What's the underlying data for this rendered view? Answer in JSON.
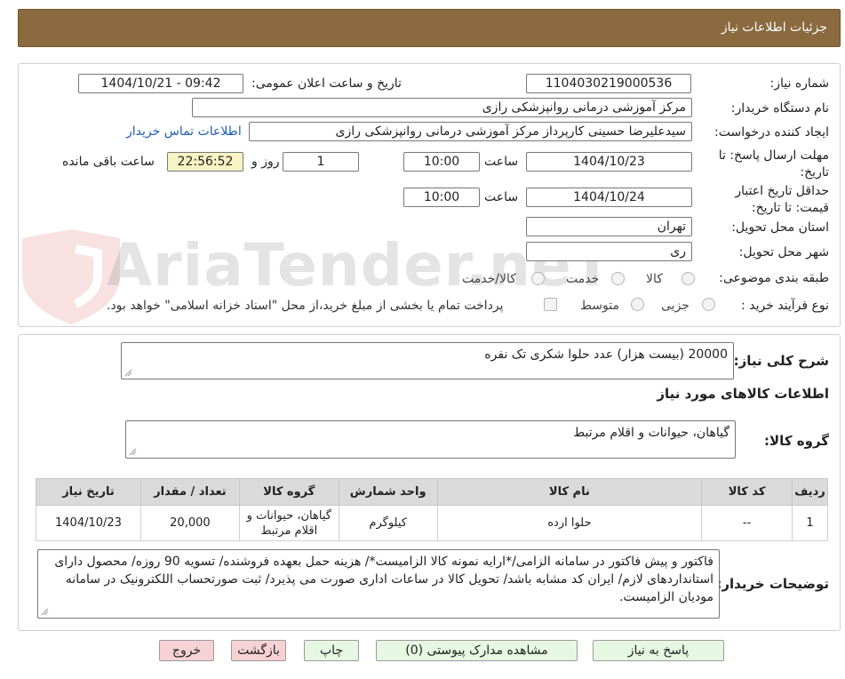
{
  "header": {
    "title": "جزئیات اطلاعات نیاز"
  },
  "form": {
    "need_number": {
      "label": "شماره نیاز:",
      "value": "1104030219000536"
    },
    "announce_datetime": {
      "label": "تاریخ و ساعت اعلان عمومی:",
      "value": "1404/10/21 - 09:42"
    },
    "buyer_org": {
      "label": "نام دستگاه خریدار:",
      "value": "مرکز آموزشی درمانی روانپزشکی رازی"
    },
    "requester": {
      "label": "ایجاد کننده درخواست:",
      "value": "سیدعلیرضا حسینی کارپرداز مرکز آموزشی درمانی روانپزشکی رازی"
    },
    "contact_link": "اطلاعات تماس خریدار",
    "reply_deadline": {
      "label": "مهلت ارسال پاسخ: تا تاریخ:",
      "date": "1404/10/23",
      "time_label": "ساعت",
      "time": "10:00",
      "days": "1",
      "days_label": "روز و",
      "remaining": "22:56:52",
      "remaining_label": "ساعت باقی مانده"
    },
    "price_validity": {
      "label": "حداقل تاریخ اعتبار قیمت: تا تاریخ:",
      "date": "1404/10/24",
      "time_label": "ساعت",
      "time": "10:00"
    },
    "delivery_province": {
      "label": "استان محل تحویل:",
      "value": "تهران"
    },
    "delivery_city": {
      "label": "شهر محل تحویل:",
      "value": "ری"
    },
    "category": {
      "label": "طبقه بندی موضوعی:",
      "options": [
        "کالا",
        "خدمت",
        "کالا/خدمت"
      ]
    },
    "purchase_process": {
      "label": "نوع فرآیند خرید :",
      "options": [
        "جزیی",
        "متوسط"
      ],
      "note": "پرداخت تمام یا بخشی از مبلغ خرید،از محل \"اسناد خزانه اسلامی\" خواهد بود."
    }
  },
  "description": {
    "summary_label": "شرح کلی نیاز:",
    "summary_value": "20000 (بیست هزار) عدد حلوا شکری تک نفره",
    "items_heading": "اطلاعات کالاهای مورد نیاز",
    "goods_group_label": "گروه کالا:",
    "goods_group_value": "گیاهان، حیوانات و اقلام مرتبط"
  },
  "table": {
    "headers": [
      "ردیف",
      "کد کالا",
      "نام کالا",
      "واحد شمارش",
      "گروه کالا",
      "تعداد / مقدار",
      "تاریخ نیاز"
    ],
    "rows": [
      [
        "1",
        "--",
        "حلوا ارده",
        "کیلوگرم",
        "گیاهان، حیوانات و اقلام مرتبط",
        "20,000",
        "1404/10/23"
      ]
    ]
  },
  "buyer_notes": {
    "label": "توضیحات خریدار:",
    "value": "فاکتور و پیش فاکتور در سامانه الزامی/*ارایه نمونه کالا الزامیست*/ هزینه حمل بعهده فروشنده/ تسویه 90 روزه/ محصول دارای استانداردهای لازم/ ایران کد مشابه باشد/ تحویل کالا در ساعات اداری صورت می پذیرد/ ثبت صورتحساب اللکترونیک در سامانه مودیان الزامیست."
  },
  "buttons": {
    "reply": "پاسخ به نیاز",
    "attachments": "مشاهده مدارک پیوستی (0)",
    "print": "چاپ",
    "back": "بازگشت",
    "exit": "خروج"
  },
  "watermark": "AriaTender.neT",
  "colors": {
    "header_bg": "#8a6a3e",
    "table_header_bg": "#dadada",
    "link": "#1c5fb8",
    "green_btn": "#e6f7e2",
    "red_btn": "#f7d2d4",
    "remaining_bg": "#f7f3c4"
  }
}
